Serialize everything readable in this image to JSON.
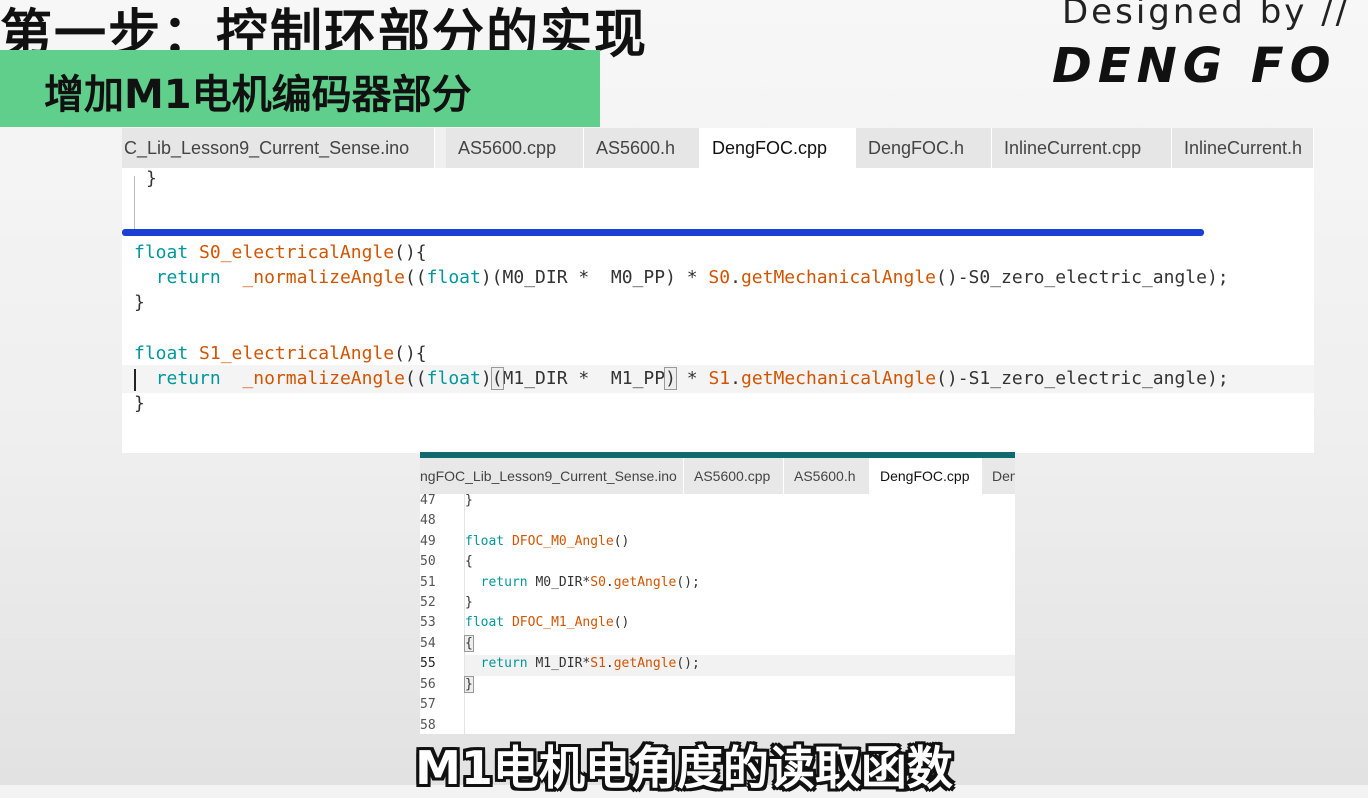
{
  "header": {
    "title": "第一步：控制环部分的实现",
    "subtitle": "增加M1电机编码器部分"
  },
  "brand": {
    "designed_by": "Designed by  //",
    "logo": "DENG FO"
  },
  "colors": {
    "banner_green": "#5fcf8b",
    "accent_blue": "#1a3fd6",
    "keyword": "#00979c",
    "function": "#d35400"
  },
  "editor_top": {
    "tabs": [
      {
        "label": "C_Lib_Lesson9_Current_Sense.ino"
      },
      {
        "label": "AS5600.cpp"
      },
      {
        "label": "AS5600.h"
      },
      {
        "label": "DengFOC.cpp",
        "active": true
      },
      {
        "label": "DengFOC.h"
      },
      {
        "label": "InlineCurrent.cpp"
      },
      {
        "label": "InlineCurrent.h"
      }
    ],
    "lines": {
      "l0": "}",
      "l1_kw": "float",
      "l1_fn": "S0_electricalAngle",
      "l1_rest": "(){",
      "l2_kw": "return",
      "l2_fn": "_normalizeAngle",
      "l2_a": "((",
      "l2_kw2": "float",
      "l2_b": ")(M0_DIR *  M0_PP) * ",
      "l2_obj": "S0",
      "l2_c": ".",
      "l2_fn2": "getMechanicalAngle",
      "l2_d": "()-S0_zero_electric_angle);",
      "l3": "}",
      "l4_kw": "float",
      "l4_fn": "S1_electricalAngle",
      "l4_rest": "(){",
      "l5_kw": "return",
      "l5_fn": "_normalizeAngle",
      "l5_a": "((",
      "l5_kw2": "float",
      "l5_b": ")",
      "l5_p1": "(",
      "l5_c": "M1_DIR *  M1_PP",
      "l5_p2": ")",
      "l5_d": " * ",
      "l5_obj": "S1",
      "l5_e": ".",
      "l5_fn2": "getMechanicalAngle",
      "l5_f": "()-S1_zero_electric_angle);",
      "l6": "}"
    }
  },
  "editor_bottom": {
    "tabs": [
      {
        "label": "ngFOC_Lib_Lesson9_Current_Sense.ino"
      },
      {
        "label": "AS5600.cpp"
      },
      {
        "label": "AS5600.h"
      },
      {
        "label": "DengFOC.cpp",
        "active": true
      },
      {
        "label": "Den"
      }
    ],
    "line_numbers": [
      "47",
      "48",
      "49",
      "50",
      "51",
      "52",
      "53",
      "54",
      "55",
      "56",
      "57",
      "58"
    ],
    "code": {
      "c47": "}",
      "c49_kw": "float",
      "c49_fn": "DFOC_M0_Angle",
      "c49_rest": "()",
      "c50": "{",
      "c51_kw": "return",
      "c51_a": " M0_DIR*",
      "c51_obj": "S0",
      "c51_b": ".",
      "c51_fn": "getAngle",
      "c51_c": "();",
      "c52": "}",
      "c53_kw": "float",
      "c53_fn": "DFOC_M1_Angle",
      "c53_rest": "()",
      "c54": "{",
      "c55_kw": "return",
      "c55_a": " M1_DIR*",
      "c55_obj": "S1",
      "c55_b": ".",
      "c55_fn": "getAngle",
      "c55_c": "();",
      "c56": "}"
    }
  },
  "caption": "M1电机电角度的读取函数"
}
